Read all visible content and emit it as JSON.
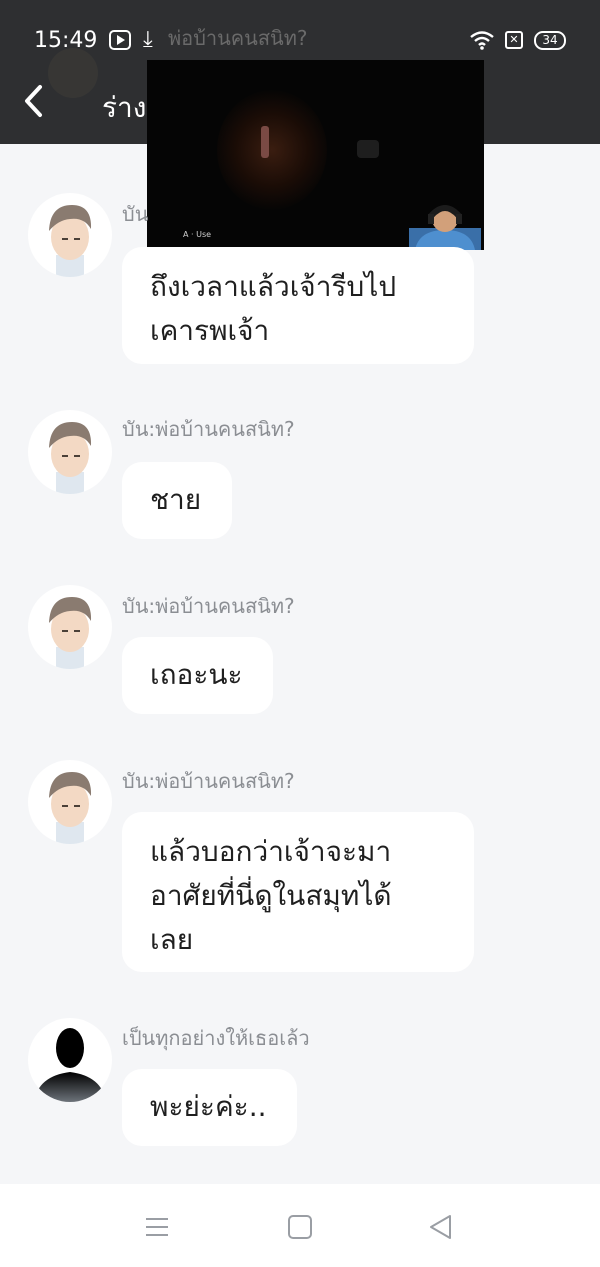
{
  "status_bar": {
    "time": "15:49",
    "faded_title": "พ่อบ้านคนสนิท?",
    "sim_symbol": "✕",
    "battery": "34",
    "icons": [
      "video-app-icon",
      "download-icon",
      "wifi-icon",
      "sim-icon",
      "battery-icon"
    ]
  },
  "header": {
    "title": "ร่าง",
    "back_icon": "chevron-left-icon"
  },
  "pip_overlay": {
    "caption": "A · Use"
  },
  "messages": [
    {
      "sender": "บัน",
      "text_lines": [
        "ถึงเวลาแล้วเจ้ารีบไป",
        "เคารพเจ้า"
      ],
      "avatar": "butler-avatar"
    },
    {
      "sender": "บัน:พ่อบ้านคนสนิท?",
      "text_lines": [
        "ชาย"
      ],
      "avatar": "butler-avatar"
    },
    {
      "sender": "บัน:พ่อบ้านคนสนิท?",
      "text_lines": [
        "เถอะนะ"
      ],
      "avatar": "butler-avatar"
    },
    {
      "sender": "บัน:พ่อบ้านคนสนิท?",
      "text_lines": [
        "แล้วบอกว่าเจ้าจะมา",
        "อาศัยที่นี่ดูในสมุทได้",
        "เลย"
      ],
      "avatar": "butler-avatar"
    },
    {
      "sender": "เป็นทุกอย่างให้เธอเล้ว",
      "text_lines": [
        "พะย่ะค่ะ.."
      ],
      "avatar": "silhouette-avatar"
    }
  ],
  "nav_bar": {
    "buttons": [
      "menu-icon",
      "home-icon",
      "back-triangle-icon"
    ]
  },
  "colors": {
    "header_bg": "#2e2f31",
    "page_bg": "#f5f6f8",
    "bubble_bg": "#ffffff",
    "sender_text": "#8b8e93",
    "message_text": "#1f1f1f"
  }
}
